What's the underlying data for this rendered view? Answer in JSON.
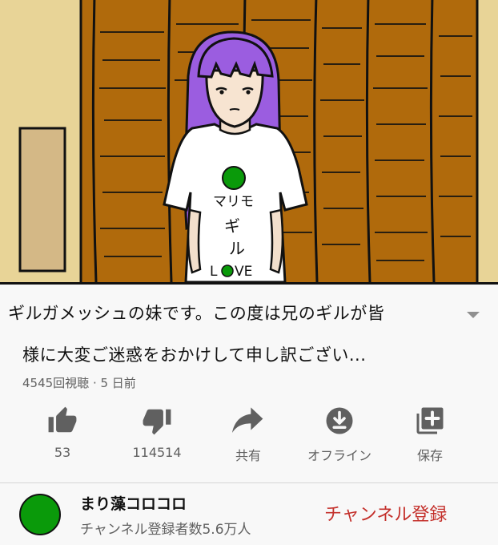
{
  "video": {
    "shirt_text": [
      "マリモ",
      "ギ",
      "ル",
      "L",
      "VE"
    ],
    "colors": {
      "wall": "#e8d497",
      "door": "#b06a0c",
      "hair": "#9b5de0",
      "dot": "#0a9a0a"
    }
  },
  "title": {
    "line1": "ギルガメッシュの妹です。この度は兄のギルが皆",
    "line2": "様に大変ご迷惑をおかけして申し訳ござい...",
    "expand_icon": "chevron-down-icon"
  },
  "meta": "4545回視聴 · 5 日前",
  "actions": [
    {
      "icon": "thumbs-up-icon",
      "label": "53"
    },
    {
      "icon": "thumbs-down-icon",
      "label": "114514"
    },
    {
      "icon": "share-icon",
      "label": "共有"
    },
    {
      "icon": "download-icon",
      "label": "オフライン"
    },
    {
      "icon": "add-to-playlist-icon",
      "label": "保存"
    }
  ],
  "channel": {
    "name": "まり藻コロコロ",
    "subscribers": "チャンネル登録者数5.6万人",
    "subscribe_label": "チャンネル登録",
    "avatar_color": "#0a9a0a",
    "subscribe_color": "#c4302b"
  }
}
